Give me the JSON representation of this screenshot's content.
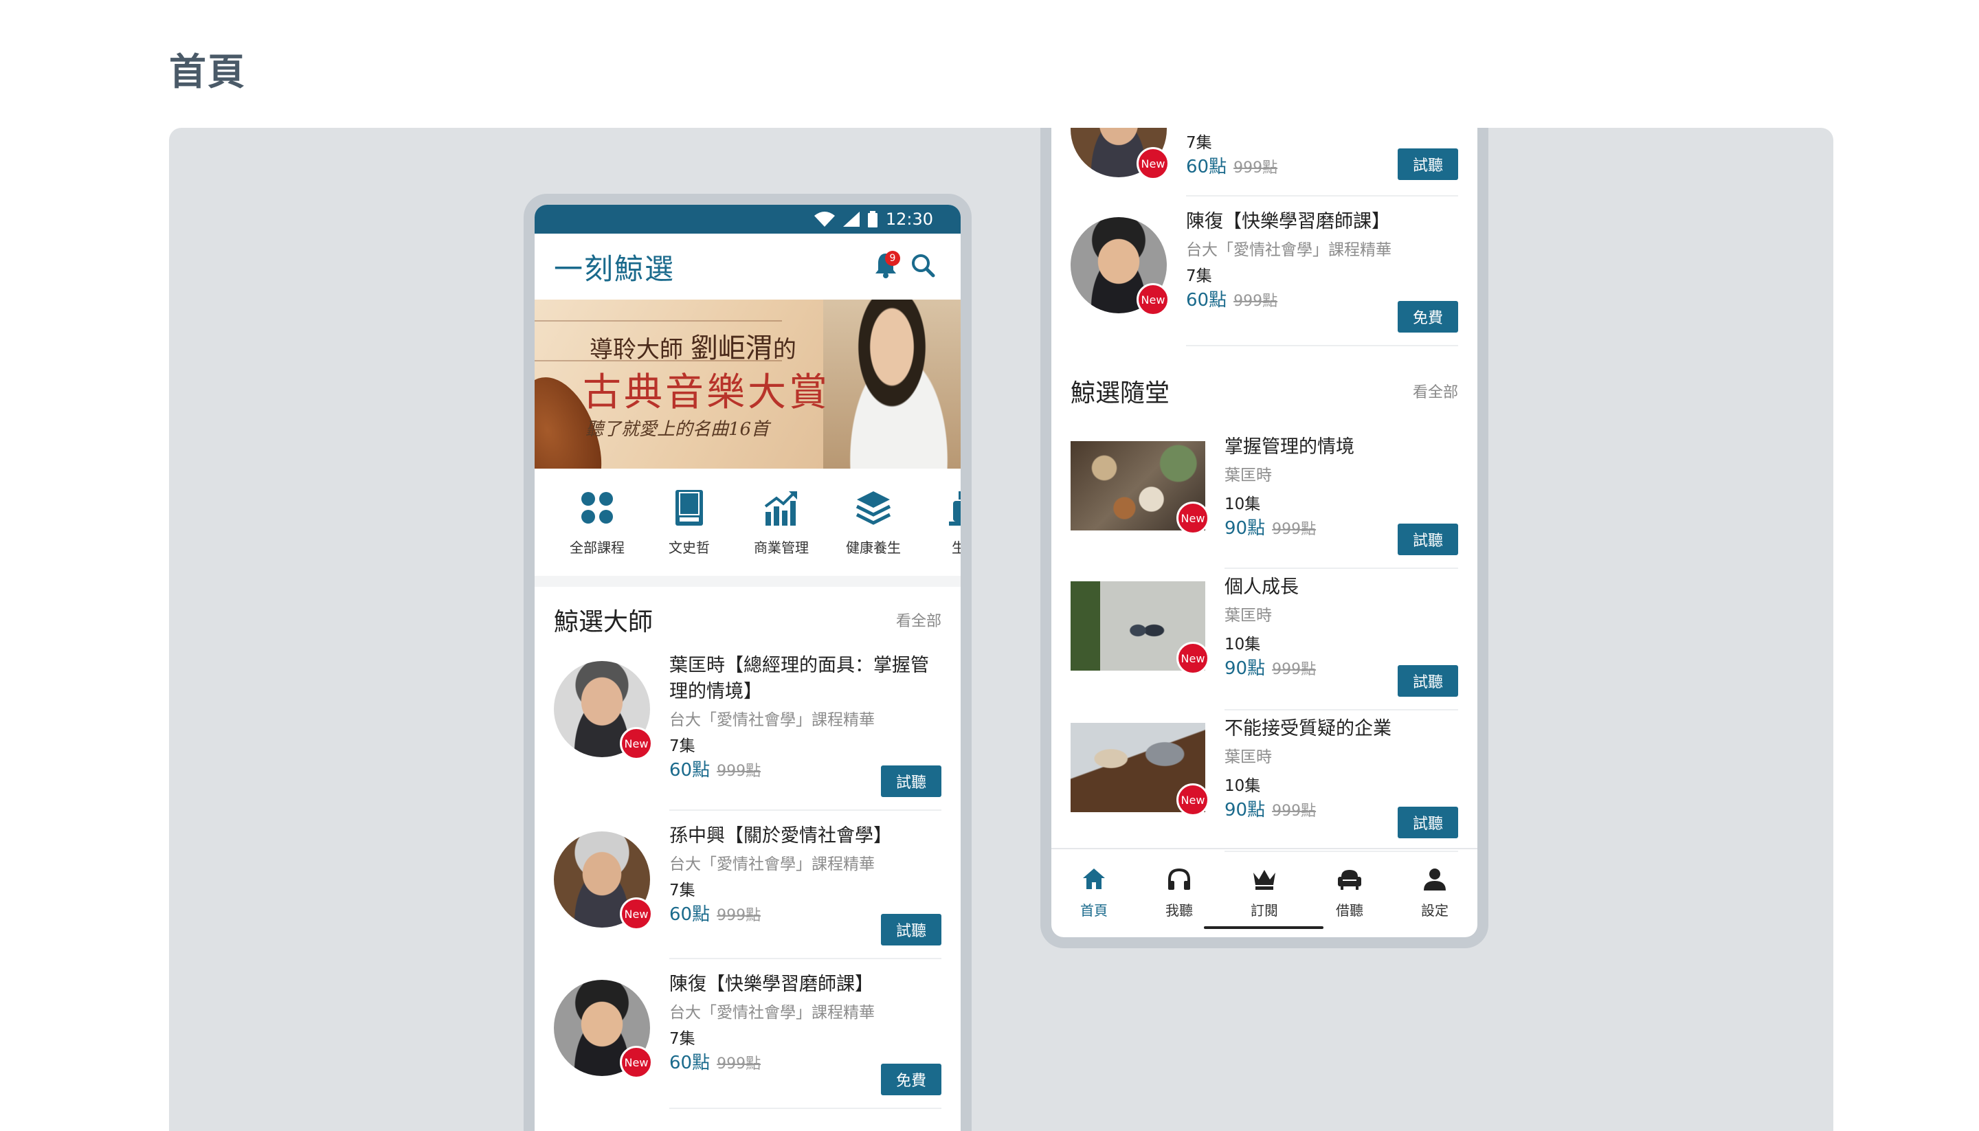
{
  "page": {
    "heading": "首頁"
  },
  "status": {
    "time": "12:30"
  },
  "app": {
    "logo": "一刻鯨選",
    "notification_count": "9"
  },
  "banner": {
    "line1_prefix": "導聆大師",
    "line1_name": "劉岠渭",
    "line1_suffix": "的",
    "line2": "古典音樂大賞",
    "line3": "聽了就愛上的名曲",
    "line3_num": "16",
    "line3_unit": "首"
  },
  "categories": [
    {
      "label": "全部課程",
      "icon": "grid-icon"
    },
    {
      "label": "文史哲",
      "icon": "book-icon"
    },
    {
      "label": "商業管理",
      "icon": "chart-icon"
    },
    {
      "label": "健康養生",
      "icon": "layers-icon"
    },
    {
      "label": "生活",
      "icon": "cup-icon"
    }
  ],
  "masters": {
    "title": "鯨選大師",
    "see_all": "看全部",
    "items": [
      {
        "title_l1": "葉匡時【總經理的面具：掌握管",
        "title_l2": "理的情境】",
        "subtitle": "台大「愛情社會學」課程精華",
        "episodes": "7集",
        "price": "60點",
        "old_price": "999點",
        "button": "試聽",
        "badge": "New"
      },
      {
        "title_l1": "孫中興【關於愛情社會學】",
        "subtitle": "台大「愛情社會學」課程精華",
        "episodes": "7集",
        "price": "60點",
        "old_price": "999點",
        "button": "試聽",
        "badge": "New"
      },
      {
        "title_l1": "陳復【快樂學習磨師課】",
        "subtitle": "台大「愛情社會學」課程精華",
        "episodes": "7集",
        "price": "60點",
        "old_price": "999點",
        "button": "免費",
        "badge": "New"
      }
    ]
  },
  "phone2": {
    "top_partial": {
      "episodes": "7集",
      "price": "60點",
      "old_price": "999點",
      "button": "試聽",
      "badge": "New"
    },
    "top_item": {
      "title": "陳復【快樂學習磨師課】",
      "subtitle": "台大「愛情社會學」課程精華",
      "episodes": "7集",
      "price": "60點",
      "old_price": "999點",
      "button": "免費",
      "badge": "New"
    },
    "section": {
      "title": "鯨選隨堂",
      "see_all": "看全部",
      "items": [
        {
          "title": "掌握管理的情境",
          "author": "葉匡時",
          "episodes": "10集",
          "price": "90點",
          "old_price": "999點",
          "button": "試聽",
          "badge": "New"
        },
        {
          "title": "個人成長",
          "author": "葉匡時",
          "episodes": "10集",
          "price": "90點",
          "old_price": "999點",
          "button": "試聽",
          "badge": "New"
        },
        {
          "title": "不能接受質疑的企業",
          "author": "葉匡時",
          "episodes": "10集",
          "price": "90點",
          "old_price": "999點",
          "button": "試聽",
          "badge": "New"
        }
      ]
    },
    "nav": [
      {
        "label": "首頁",
        "icon": "home-icon"
      },
      {
        "label": "我聽",
        "icon": "headphones-icon"
      },
      {
        "label": "訂閱",
        "icon": "crown-icon"
      },
      {
        "label": "借聽",
        "icon": "armchair-icon"
      },
      {
        "label": "設定",
        "icon": "person-icon"
      }
    ]
  },
  "colors": {
    "primary": "#1a6a8c",
    "status_bar": "#1a5f80",
    "badge": "#d9102a",
    "board": "#dee1e4"
  }
}
